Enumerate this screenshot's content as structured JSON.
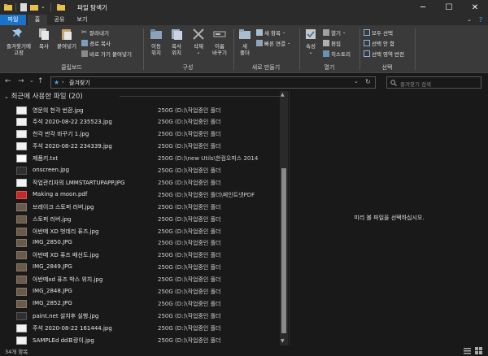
{
  "window": {
    "title": "파일 탐색기",
    "minimize_icon": "─",
    "maximize_icon": "☐",
    "close_icon": "✕"
  },
  "ribbon_tabs": [
    {
      "label": "파일"
    },
    {
      "label": "홈"
    },
    {
      "label": "공유"
    },
    {
      "label": "보기"
    }
  ],
  "ribbon": {
    "clipboard": {
      "pin_label_1": "즐겨찾기에",
      "pin_label_2": "고정",
      "copy": "복사",
      "paste": "붙여넣기",
      "cut": "잘라내기",
      "copy_path": "경로 복사",
      "paste_shortcut": "바로 가기 붙여넣기",
      "group_label": "클립보드"
    },
    "organize": {
      "move_1": "이동",
      "move_2": "위치",
      "copyto_1": "복사",
      "copyto_2": "위치",
      "delete": "삭제",
      "rename_1": "이름",
      "rename_2": "바꾸기",
      "group_label": "구성"
    },
    "new": {
      "folder_1": "새",
      "folder_2": "폴더",
      "new_item": "새 항목",
      "easy_access": "빠른 연결",
      "group_label": "새로 만들기"
    },
    "open": {
      "properties": "속성",
      "open": "열기",
      "edit": "편집",
      "history": "히스토리",
      "group_label": "열기"
    },
    "select": {
      "select_all": "모두 선택",
      "select_none": "선택 안 함",
      "invert": "선택 영역 반전",
      "group_label": "선택"
    }
  },
  "nav": {
    "back": "←",
    "forward": "→",
    "recent": "⌄",
    "up": "↑",
    "crumb": "즐겨찾기",
    "crumb_sep": "›",
    "refresh": "↻",
    "dropdown": "⌄",
    "search_placeholder": "즐겨찾기 검색"
  },
  "list": {
    "group_header": "최근에 사용한 파일 (20)",
    "files": [
      {
        "name": "영문의 천각 번환.jpg",
        "path": "250G (D:)\\작업중인 폴더",
        "thumb": "image"
      },
      {
        "name": "주석 2020-08-22 235523.jpg",
        "path": "250G (D:)\\작업중인 폴더",
        "thumb": "image"
      },
      {
        "name": "천각 반각 바꾸기 1.jpg",
        "path": "250G (D:)\\작업중인 폴더",
        "thumb": "image"
      },
      {
        "name": "주석 2020-08-22 234339.jpg",
        "path": "250G (D:)\\작업중인 폴더",
        "thumb": "image"
      },
      {
        "name": "제품키.txt",
        "path": "250G (D:)\\new Utils\\한컴오피스 2014",
        "thumb": "text"
      },
      {
        "name": "onscreen.jpg",
        "path": "250G (D:)\\작업중인 폴더",
        "thumb": "dark"
      },
      {
        "name": "작업관리자의 LMMSTARTUPAPP.JPG",
        "path": "250G (D:)\\작업중인 폴더",
        "thumb": "image"
      },
      {
        "name": "Making a moon.pdf",
        "path": "250G (D:)\\작업중인 폴더\\페인트넷PDF",
        "thumb": "pdf"
      },
      {
        "name": "브레이크 스토퍼 러버.jpg",
        "path": "250G (D:)\\작업중인 폴더",
        "thumb": "photo"
      },
      {
        "name": "스토퍼 러버.jpg",
        "path": "250G (D:)\\작업중인 폴더",
        "thumb": "photo"
      },
      {
        "name": "아반떼 XD 벗데리 퓨즈.jpg",
        "path": "250G (D:)\\작업중인 폴더",
        "thumb": "photo"
      },
      {
        "name": "IMG_2850.JPG",
        "path": "250G (D:)\\작업중인 폴더",
        "thumb": "photo"
      },
      {
        "name": "아반떼 XD 퓨즈 배선도.jpg",
        "path": "250G (D:)\\작업중인 폴더",
        "thumb": "photo"
      },
      {
        "name": "IMG_2849.JPG",
        "path": "250G (D:)\\작업중인 폴더",
        "thumb": "photo"
      },
      {
        "name": "아반떼xd 퓨즈 박스 위치.jpg",
        "path": "250G (D:)\\작업중인 폴더",
        "thumb": "photo"
      },
      {
        "name": "IMG_2848.JPG",
        "path": "250G (D:)\\작업중인 폴더",
        "thumb": "photo"
      },
      {
        "name": "IMG_2852.JPG",
        "path": "250G (D:)\\작업중인 폴더",
        "thumb": "photo"
      },
      {
        "name": "paint.net 설치후 실행.jpg",
        "path": "250G (D:)\\작업중인 폴더",
        "thumb": "dark"
      },
      {
        "name": "주석 2020-08-22 161444.jpg",
        "path": "250G (D:)\\작업중인 폴더",
        "thumb": "image"
      },
      {
        "name": "SAMPLEd dd표랑이.jpg",
        "path": "250G (D:)\\작업중인 폴더",
        "thumb": "image"
      }
    ]
  },
  "preview": {
    "message": "미리 볼 파일을 선택하십시오."
  },
  "status": {
    "count": "34개 항목"
  },
  "colors": {
    "accent": "#1a73c8",
    "background": "#191919",
    "ribbon": "#3a3a3a"
  }
}
